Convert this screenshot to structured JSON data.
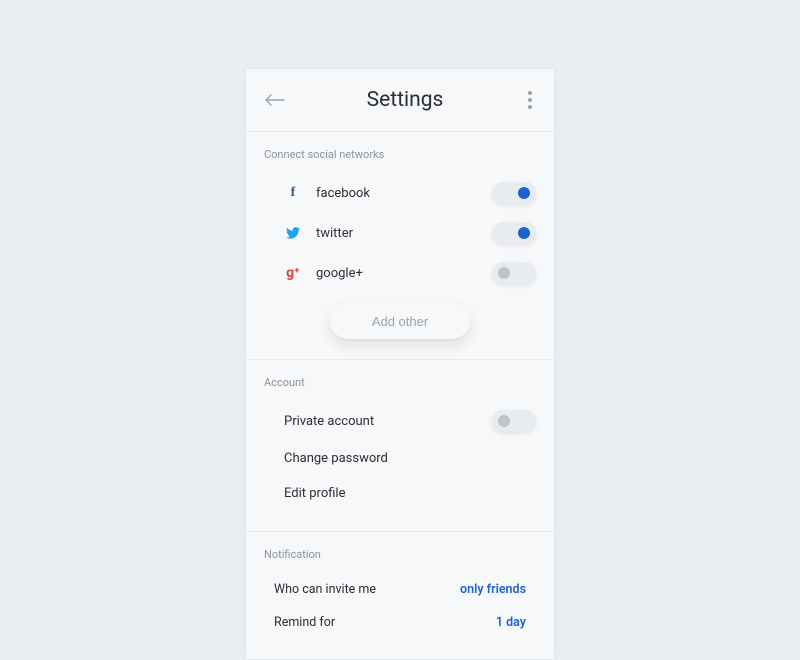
{
  "header": {
    "title": "Settings"
  },
  "social": {
    "section_title": "Connect social networks",
    "items": [
      {
        "label": "facebook",
        "on": true
      },
      {
        "label": "twitter",
        "on": true
      },
      {
        "label": "google+",
        "on": false
      }
    ],
    "add_button": "Add other"
  },
  "account": {
    "section_title": "Account",
    "private_label": "Private account",
    "private_on": false,
    "change_password": "Change password",
    "edit_profile": "Edit profile"
  },
  "notification": {
    "section_title": "Notification",
    "who_label": "Who can invite me",
    "who_value": "only friends",
    "remind_label": "Remind for",
    "remind_value": "1 day"
  }
}
